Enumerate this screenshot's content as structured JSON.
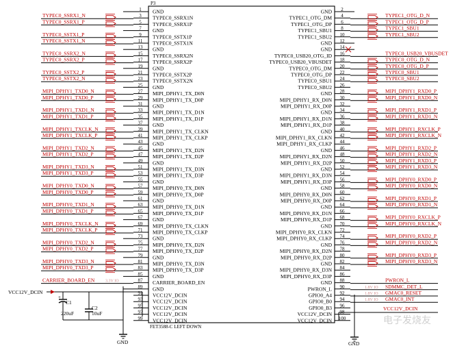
{
  "component": {
    "designator": "P3",
    "part_name": "FET3588-C LEFT DOWN"
  },
  "left_pins": [
    {
      "num": "1",
      "name": "GND",
      "net": ""
    },
    {
      "num": "3",
      "name": "TYPEC0_SSRX1N",
      "net": "TYPEC0_SSRX1_N",
      "flag": true
    },
    {
      "num": "5",
      "name": "TYPEC0_SSRX1P",
      "net": "TYPEC0_SSRX1_P",
      "flag": true
    },
    {
      "num": "7",
      "name": "GND",
      "net": ""
    },
    {
      "num": "9",
      "name": "TYPEC0_SSTX1P",
      "net": "TYPEC0_SSTX1_P",
      "flag": true
    },
    {
      "num": "11",
      "name": "TYPEC0_SSTX1N",
      "net": "TYPEC0_SSTX1_N",
      "flag": true
    },
    {
      "num": "13",
      "name": "GND",
      "net": ""
    },
    {
      "num": "15",
      "name": "TYPEC0_SSRX2N",
      "net": "TYPEC0_SSRX2_N",
      "flag": true
    },
    {
      "num": "17",
      "name": "TYPEC0_SSRX2P",
      "net": "TYPEC0_SSRX2_P",
      "flag": true
    },
    {
      "num": "19",
      "name": "GND",
      "net": ""
    },
    {
      "num": "21",
      "name": "TYPEC0_SSTX2P",
      "net": "TYPEC0_SSTX2_P",
      "flag": true
    },
    {
      "num": "23",
      "name": "TYPEC0_SSTX2N",
      "net": "TYPEC0_SSTX2_N",
      "flag": true
    },
    {
      "num": "25",
      "name": "GND",
      "net": ""
    },
    {
      "num": "27",
      "name": "MIPI_DPHY1_TX_D0N",
      "net": "MIPI_DPHY1_TXD0_N",
      "flag": true
    },
    {
      "num": "29",
      "name": "MIPI_DPHY1_TX_D0P",
      "net": "MIPI_DPHY1_TXD0_P",
      "flag": true
    },
    {
      "num": "31",
      "name": "GND",
      "net": ""
    },
    {
      "num": "33",
      "name": "MIPI_DPHY1_TX_D1N",
      "net": "MIPI_DPHY1_TXD1_N",
      "flag": true
    },
    {
      "num": "35",
      "name": "MIPI_DPHY1_TX_D1P",
      "net": "MIPI_DPHY1_TXD1_P",
      "flag": true
    },
    {
      "num": "37",
      "name": "GND",
      "net": ""
    },
    {
      "num": "39",
      "name": "MIPI_DPHY1_TX_CLKN",
      "net": "MIPI_DPHY1_TXCLK_N",
      "flag": true
    },
    {
      "num": "41",
      "name": "MIPI_DPHY1_TX_CLKP",
      "net": "MIPI_DPHY1_TXCLK_P",
      "flag": true
    },
    {
      "num": "43",
      "name": "GND",
      "net": ""
    },
    {
      "num": "45",
      "name": "MIPI_DPHY1_TX_D2N",
      "net": "MIPI_DPHY1_TXD2_N",
      "flag": true
    },
    {
      "num": "47",
      "name": "MIPI_DPHY1_TX_D2P",
      "net": "MIPI_DPHY1_TXD2_P",
      "flag": true
    },
    {
      "num": "49",
      "name": "GND",
      "net": ""
    },
    {
      "num": "51",
      "name": "MIPI_DPHY1_TX_D3N",
      "net": "MIPI_DPHY1_TXD3_N",
      "flag": true
    },
    {
      "num": "53",
      "name": "MIPI_DPHY1_TX_D3P",
      "net": "MIPI_DPHY1_TXD3_P",
      "flag": true
    },
    {
      "num": "55",
      "name": "GND",
      "net": ""
    },
    {
      "num": "57",
      "name": "MIPI_DPHY0_TX_D0N",
      "net": "MIPI_DPHY0_TXD0_N",
      "flag": true
    },
    {
      "num": "59",
      "name": "MIPI_DPHY0_TX_D0P",
      "net": "MIPI_DPHY0_TXD0_P",
      "flag": true
    },
    {
      "num": "61",
      "name": "GND",
      "net": ""
    },
    {
      "num": "63",
      "name": "MIPI_DPHY0_TX_D1N",
      "net": "MIPI_DPHY0_TXD1_N",
      "flag": true
    },
    {
      "num": "65",
      "name": "MIPI_DPHY0_TX_D1P",
      "net": "MIPI_DPHY0_TXD1_P",
      "flag": true
    },
    {
      "num": "67",
      "name": "GND",
      "net": ""
    },
    {
      "num": "69",
      "name": "MIPI_DPHY0_TX_CLKN",
      "net": "MIPI_DPHY0_TXCLK_N",
      "flag": true
    },
    {
      "num": "71",
      "name": "MIPI_DPHY0_TX_CLKP",
      "net": "MIPI_DPHY0_TXCLK_P",
      "flag": true
    },
    {
      "num": "73",
      "name": "GND",
      "net": ""
    },
    {
      "num": "75",
      "name": "MIPI_DPHY0_TX_D2N",
      "net": "MIPI_DPHY0_TXD2_N",
      "flag": true
    },
    {
      "num": "77",
      "name": "MIPI_DPHY0_TX_D2P",
      "net": "MIPI_DPHY0_TXD2_P",
      "flag": true
    },
    {
      "num": "79",
      "name": "GND",
      "net": ""
    },
    {
      "num": "81",
      "name": "MIPI_DPHY0_TX_D3N",
      "net": "MIPI_DPHY0_TXD3_N",
      "flag": true
    },
    {
      "num": "83",
      "name": "MIPI_DPHY0_TX_D3P",
      "net": "MIPI_DPHY0_TXD3_P",
      "flag": true
    },
    {
      "num": "85",
      "name": "GND",
      "net": ""
    },
    {
      "num": "87",
      "name": "CARRIER_BOARD_EN",
      "net": "CARRIER_BOARD_EN",
      "tag": "3.3V IO"
    },
    {
      "num": "89",
      "name": "GND",
      "net": ""
    },
    {
      "num": "91",
      "name": "VCC12V_DCIN",
      "net": ""
    },
    {
      "num": "93",
      "name": "VCC12V_DCIN",
      "net": ""
    },
    {
      "num": "95",
      "name": "VCC12V_DCIN",
      "net": ""
    },
    {
      "num": "97",
      "name": "VCC12V_DCIN",
      "net": ""
    },
    {
      "num": "99",
      "name": "VCC12V_DCIN",
      "net": ""
    }
  ],
  "right_pins": [
    {
      "num": "2",
      "name": "GND",
      "net": ""
    },
    {
      "num": "4",
      "name": "TYPEC1_OTG_DM",
      "net": "TYPEC1_OTG_D_N",
      "flag": true
    },
    {
      "num": "6",
      "name": "TYPEC1_OTG_DP",
      "net": "TYPEC1_OTG_D_P",
      "flag": true
    },
    {
      "num": "8",
      "name": "TYPEC1_SBU1",
      "net": "TYPEC1_SBU1",
      "flag": true
    },
    {
      "num": "10",
      "name": "TYPEC1_SBU2",
      "net": "TYPEC1_SBU2",
      "flag": true
    },
    {
      "num": "12",
      "name": "GND",
      "net": ""
    },
    {
      "num": "14",
      "name": "GND",
      "net": "",
      "nc": true
    },
    {
      "num": "16",
      "name": "TYPEC0_USB20_OTG_ID",
      "net": "TYPEC0_USB20_VBUSDET",
      "cross": true
    },
    {
      "num": "18",
      "name": "TYPEC0_USB20_VBUSDET",
      "net": "TYPEC0_OTG_D_N",
      "flag": true
    },
    {
      "num": "20",
      "name": "TYPEC0_OTG_DM",
      "net": "TYPEC0_OTG_D_P",
      "flag": true
    },
    {
      "num": "22",
      "name": "TYPEC0_OTG_DP",
      "net": "TYPEC0_SBU1",
      "flag": true
    },
    {
      "num": "24",
      "name": "TYPEC0_SBU1",
      "net": "TYPEC0_SBU2",
      "flag": true
    },
    {
      "num": "26",
      "name": "TYPEC0_SBU2",
      "net": ""
    },
    {
      "num": "28",
      "name": "GND",
      "net": "MIPI_DPHY1_RXD0_P",
      "flag": true
    },
    {
      "num": "30",
      "name": "MIPI_DPHY1_RX_D0N",
      "net": "MIPI_DPHY1_RXD0_N",
      "flag": true
    },
    {
      "num": "32",
      "name": "MIPI_DPHY1_RX_D0P",
      "net": ""
    },
    {
      "num": "34",
      "name": "GND",
      "net": "MIPI_DPHY1_RXD1_P",
      "flag": true
    },
    {
      "num": "36",
      "name": "MIPI_DPHY1_RX_D1N",
      "net": "MIPI_DPHY1_RXD1_N",
      "flag": true
    },
    {
      "num": "38",
      "name": "MIPI_DPHY1_RX_D1P",
      "net": ""
    },
    {
      "num": "40",
      "name": "GND",
      "net": "MIPI_DPHY1_RXCLK_P",
      "flag": true
    },
    {
      "num": "42",
      "name": "MIPI_DPHY1_RX_CLKN",
      "net": "MIPI_DPHY1_RXCLK_N",
      "flag": true
    },
    {
      "num": "44",
      "name": "MIPI_DPHY1_RX_CLKP",
      "net": ""
    },
    {
      "num": "46",
      "name": "GND",
      "net": "MIPI_DPHY1_RXD2_P",
      "flag": true
    },
    {
      "num": "48",
      "name": "MIPI_DPHY1_RX_D2N",
      "net": "MIPI_DPHY1_RXD2_N",
      "flag": true
    },
    {
      "num": "50",
      "name": "MIPI_DPHY1_RX_D2P",
      "net": "MIPI_DPHY1_RXD3_P",
      "flag": true
    },
    {
      "num": "52",
      "name": "GND",
      "net": "MIPI_DPHY1_RXD3_N",
      "flag": true
    },
    {
      "num": "54",
      "name": "MIPI_DPHY1_RX_D3N",
      "net": ""
    },
    {
      "num": "56",
      "name": "MIPI_DPHY1_RX_D3P",
      "net": "MIPI_DPHY0_RXD0_P",
      "flag": true
    },
    {
      "num": "58",
      "name": "GND",
      "net": "MIPI_DPHY0_RXD0_N",
      "flag": true
    },
    {
      "num": "60",
      "name": "MIPI_DPHY0_RX_D0N",
      "net": ""
    },
    {
      "num": "62",
      "name": "MIPI_DPHY0_RX_D0P",
      "net": "MIPI_DPHY0_RXD1_P",
      "flag": true
    },
    {
      "num": "64",
      "name": "GND",
      "net": "MIPI_DPHY0_RXD1_N",
      "flag": true
    },
    {
      "num": "66",
      "name": "MIPI_DPHY0_RX_D1N",
      "net": ""
    },
    {
      "num": "68",
      "name": "MIPI_DPHY0_RX_D1P",
      "net": "MIPI_DPHY0_RXCLK_P",
      "flag": true
    },
    {
      "num": "70",
      "name": "GND",
      "net": "MIPI_DPHY0_RXCLK_N",
      "flag": true
    },
    {
      "num": "72",
      "name": "MIPI_DPHY0_RX_CLKN",
      "net": ""
    },
    {
      "num": "74",
      "name": "MIPI_DPHY0_RX_CLKP",
      "net": "MIPI_DPHY0_RXD2_P",
      "flag": true
    },
    {
      "num": "76",
      "name": "GND",
      "net": "MIPI_DPHY0_RXD2_N",
      "flag": true
    },
    {
      "num": "78",
      "name": "MIPI_DPHY0_RX_D2N",
      "net": ""
    },
    {
      "num": "80",
      "name": "MIPI_DPHY0_RX_D2P",
      "net": "MIPI_DPHY0_RXD3_P",
      "flag": true
    },
    {
      "num": "82",
      "name": "GND",
      "net": "MIPI_DPHY0_RXD3_N",
      "flag": true
    },
    {
      "num": "84",
      "name": "MIPI_DPHY0_RX_D3N",
      "net": ""
    },
    {
      "num": "86",
      "name": "MIPI_DPHY0_RX_D3P",
      "net": ""
    },
    {
      "num": "88",
      "name": "GND",
      "net": "PWRON_L"
    },
    {
      "num": "90",
      "name": "PWRON_L",
      "net": "SDMMC_DET_L",
      "tag": "1.8V IO"
    },
    {
      "num": "92",
      "name": "GPIO0_A4",
      "net": "GMAC0_RESET",
      "tag": "1.8V IO"
    },
    {
      "num": "94",
      "name": "GPIO0_B0",
      "net": "GMAC0_INT",
      "tag": "1.8V IO"
    },
    {
      "num": "96",
      "name": "GPIO0_B3",
      "net": ""
    },
    {
      "num": "98",
      "name": "VCC12V_DCIN",
      "net": ""
    },
    {
      "num": "100",
      "name": "VCC12V_DCIN",
      "net": ""
    }
  ],
  "power": {
    "left_net": "VCC12V_DCIN",
    "right_net": "VCC12V_DCIN",
    "gnd_label_left": "GND",
    "gnd_label_right": "GND"
  },
  "capacitors": [
    {
      "ref": "C1",
      "value": "220uF"
    },
    {
      "ref": "C2",
      "value": "10uF"
    }
  ],
  "watermark": "电子发烧友"
}
